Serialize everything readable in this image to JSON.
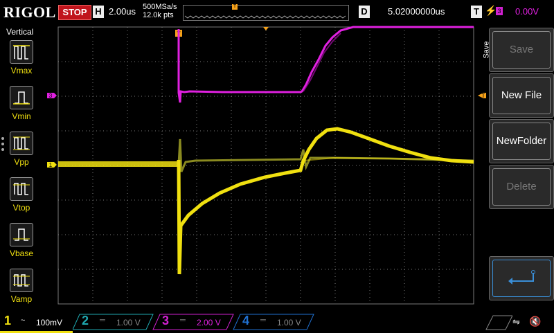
{
  "brand": "RIGOL",
  "run_state": "STOP",
  "horizontal": {
    "label": "H",
    "scale": "2.00us",
    "sample_rate": "500MSa/s",
    "points": "12.0k pts"
  },
  "trigger_marker": "T",
  "delay": {
    "label": "D",
    "value": "5.02000000us"
  },
  "trigger": {
    "label": "T",
    "edge": "⚡",
    "source": "3",
    "level": "0.00V"
  },
  "left_menu": {
    "title": "Vertical",
    "items": [
      "Vmax",
      "Vmin",
      "Vpp",
      "Vtop",
      "Vbase",
      "Vamp"
    ]
  },
  "right_menu": {
    "tab": "Save",
    "buttons": [
      {
        "label": "Save",
        "enabled": false
      },
      {
        "label": "New File",
        "enabled": true
      },
      {
        "label": "NewFolder",
        "enabled": true
      },
      {
        "label": "Delete",
        "enabled": false
      },
      {
        "label": "↵",
        "enabled": true
      }
    ]
  },
  "channels": [
    {
      "num": "1",
      "coupling": "~",
      "scale": "100mV",
      "color": "#f0e010",
      "active": true
    },
    {
      "num": "2",
      "coupling": "═",
      "scale": "1.00 V",
      "color": "#1fa8b0",
      "active": false
    },
    {
      "num": "3",
      "coupling": "═",
      "scale": "2.00 V",
      "color": "#d020d0",
      "active": false
    },
    {
      "num": "4",
      "coupling": "═",
      "scale": "1.00 V",
      "color": "#2070d0",
      "active": false
    }
  ],
  "channel_markers": {
    "ch1": "1",
    "ch3": "3"
  },
  "colors": {
    "ch1": "#f0e010",
    "ch3": "#e020e0",
    "trigger": "#f6a21a",
    "grid": "#7a7a7a"
  }
}
